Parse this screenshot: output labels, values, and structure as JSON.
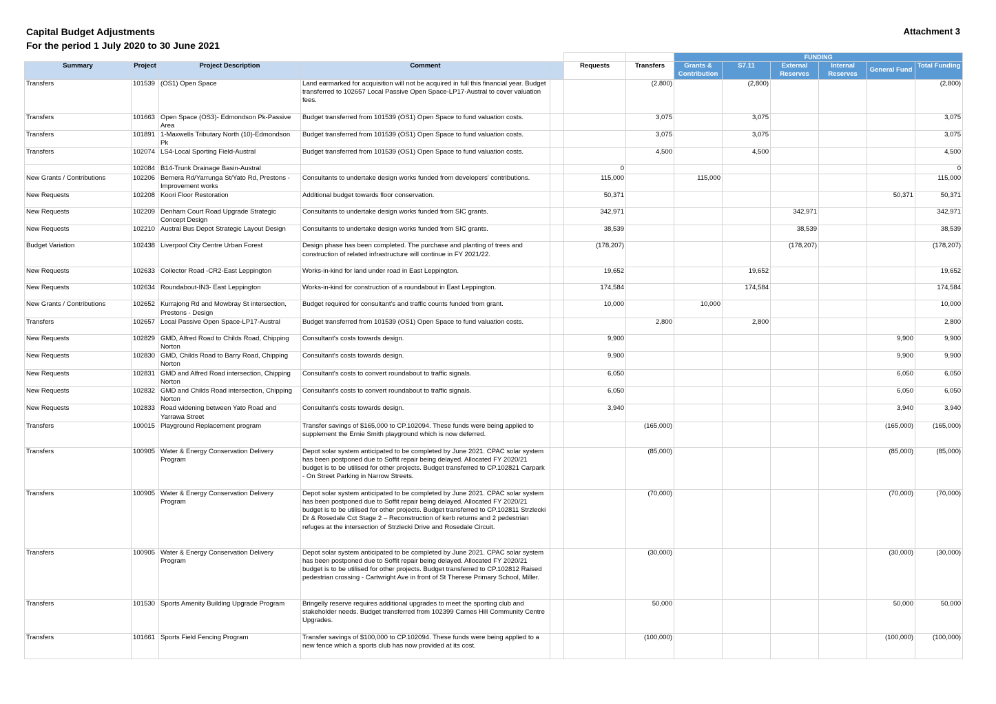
{
  "header": {
    "title_line1": "Capital Budget Adjustments",
    "title_line2": "For the period 1 July 2020 to 30 June 2021",
    "attachment": "Attachment 3"
  },
  "columns": {
    "funding_group": "FUNDING",
    "summary": "Summary",
    "project": "Project",
    "description": "Project Description",
    "comment": "Comment",
    "requests": "Requests",
    "transfers": "Transfers",
    "grants": "Grants & Contribution",
    "s711": "S7.11",
    "external": "External Reserves",
    "internal": "Internal Reserves",
    "general": "General Fund",
    "total": "Total Funding"
  },
  "rows": [
    {
      "summary": "Transfers",
      "project": "101539",
      "description": "(OS1) Open Space",
      "comment": "Land earmarked for acquisition will not be acquired in full this financial year. Budget transferred to 102657 Local Passive Open Space-LP17-Austral to cover valuation fees.",
      "requests": "",
      "transfers": "(2,800)",
      "grants": "",
      "s711": "(2,800)",
      "external": "",
      "internal": "",
      "general": "",
      "total": "(2,800)",
      "h": "three"
    },
    {
      "summary": "Transfers",
      "project": "101663",
      "description": "Open Space (OS3)- Edmondson Pk-Passive Area",
      "comment": "Budget transferred from 101539 (OS1) Open Space to fund valuation costs.",
      "requests": "",
      "transfers": "3,075",
      "grants": "",
      "s711": "3,075",
      "external": "",
      "internal": "",
      "general": "",
      "total": "3,075",
      "h": "norm"
    },
    {
      "summary": "Transfers",
      "project": "101891",
      "description": "1-Maxwells Tributary North (10)-Edmondson Pk",
      "comment": "Budget transferred from 101539 (OS1) Open Space to fund valuation costs.",
      "requests": "",
      "transfers": "3,075",
      "grants": "",
      "s711": "3,075",
      "external": "",
      "internal": "",
      "general": "",
      "total": "3,075",
      "h": "norm"
    },
    {
      "summary": "Transfers",
      "project": "102074",
      "description": "LS4-Local Sporting Field-Austral",
      "comment": "Budget transferred from 101539 (OS1) Open Space to fund valuation costs.",
      "requests": "",
      "transfers": "4,500",
      "grants": "",
      "s711": "4,500",
      "external": "",
      "internal": "",
      "general": "",
      "total": "4,500",
      "h": "norm"
    },
    {
      "summary": "",
      "project": "102084",
      "description": "B14-Trunk Drainage Basin-Austral",
      "comment": "",
      "requests": "0",
      "transfers": "",
      "grants": "",
      "s711": "",
      "external": "",
      "internal": "",
      "general": "",
      "total": "0",
      "h": "short"
    },
    {
      "summary": "New Grants / Contributions",
      "project": "102206",
      "description": "Bernera Rd/Yarrunga St/Yato Rd, Prestons - Improvement works",
      "comment": "Consultants to undertake design works funded from developers' contributions.",
      "requests": "115,000",
      "transfers": "",
      "grants": "115,000",
      "s711": "",
      "external": "",
      "internal": "",
      "general": "",
      "total": "115,000",
      "h": "norm"
    },
    {
      "summary": "New Requests",
      "project": "102208",
      "description": "Koori Floor Restoration",
      "comment": "Additional budget towards floor conservation.",
      "requests": "50,371",
      "transfers": "",
      "grants": "",
      "s711": "",
      "external": "",
      "internal": "",
      "general": "50,371",
      "total": "50,371",
      "h": "norm"
    },
    {
      "summary": "New Requests",
      "project": "102209",
      "description": "Denham Court Road Upgrade Strategic Concept Design",
      "comment": "Consultants to undertake design works funded from SIC grants.",
      "requests": "342,971",
      "transfers": "",
      "grants": "",
      "s711": "",
      "external": "342,971",
      "internal": "",
      "general": "",
      "total": "342,971",
      "h": "norm"
    },
    {
      "summary": "New Requests",
      "project": "102210",
      "description": "Austral Bus Depot Strategic Layout Design",
      "comment": "Consultants to undertake design works funded from SIC grants.",
      "requests": "38,539",
      "transfers": "",
      "grants": "",
      "s711": "",
      "external": "38,539",
      "internal": "",
      "general": "",
      "total": "38,539",
      "h": "norm"
    },
    {
      "summary": "Budget Variation",
      "project": "102438",
      "description": "Liverpool City Centre Urban Forest",
      "comment": "Design phase has been completed.  The purchase and planting of trees and construction of related infrastructure will continue in FY 2021/22.",
      "requests": "(178,207)",
      "transfers": "",
      "grants": "",
      "s711": "",
      "external": "(178,207)",
      "internal": "",
      "general": "",
      "total": "(178,207)",
      "h": "two"
    },
    {
      "summary": "New Requests",
      "project": "102633",
      "description": "Collector Road -CR2-East Leppington",
      "comment": "Works-in-kind for land under road in East Leppington.",
      "requests": "19,652",
      "transfers": "",
      "grants": "",
      "s711": "19,652",
      "external": "",
      "internal": "",
      "general": "",
      "total": "19,652",
      "h": "norm"
    },
    {
      "summary": "New Requests",
      "project": "102634",
      "description": "Roundabout-IN3- East Leppington",
      "comment": "Works-in-kind for construction of a roundabout in East Leppington.",
      "requests": "174,584",
      "transfers": "",
      "grants": "",
      "s711": "174,584",
      "external": "",
      "internal": "",
      "general": "",
      "total": "174,584",
      "h": "norm"
    },
    {
      "summary": "New Grants / Contributions",
      "project": "102652",
      "description": "Kurrajong Rd and Mowbray St intersection, Prestons - Design",
      "comment": "Budget required for consultant's and traffic counts funded from grant.",
      "requests": "10,000",
      "transfers": "",
      "grants": "10,000",
      "s711": "",
      "external": "",
      "internal": "",
      "general": "",
      "total": "10,000",
      "h": "norm"
    },
    {
      "summary": "Transfers",
      "project": "102657",
      "description": "Local Passive Open Space-LP17-Austral",
      "comment": "Budget transferred from 101539 (OS1) Open Space to fund valuation costs.",
      "requests": "",
      "transfers": "2,800",
      "grants": "",
      "s711": "2,800",
      "external": "",
      "internal": "",
      "general": "",
      "total": "2,800",
      "h": "norm"
    },
    {
      "summary": "New Requests",
      "project": "102829",
      "description": "GMD, Alfred Road to Childs Road, Chipping Norton",
      "comment": "Consultant's costs towards design.",
      "requests": "9,900",
      "transfers": "",
      "grants": "",
      "s711": "",
      "external": "",
      "internal": "",
      "general": "9,900",
      "total": "9,900",
      "h": "norm"
    },
    {
      "summary": "New Requests",
      "project": "102830",
      "description": "GMD, Childs Road to Barry Road, Chipping Norton",
      "comment": "Consultant's costs towards design.",
      "requests": "9,900",
      "transfers": "",
      "grants": "",
      "s711": "",
      "external": "",
      "internal": "",
      "general": "9,900",
      "total": "9,900",
      "h": "norm"
    },
    {
      "summary": "New Requests",
      "project": "102831",
      "description": "GMD and Alfred Road intersection, Chipping Norton",
      "comment": "Consultant's costs to convert roundabout to traffic signals.",
      "requests": "6,050",
      "transfers": "",
      "grants": "",
      "s711": "",
      "external": "",
      "internal": "",
      "general": "6,050",
      "total": "6,050",
      "h": "norm"
    },
    {
      "summary": "New Requests",
      "project": "102832",
      "description": "GMD and Childs Road intersection, Chipping Norton",
      "comment": "Consultant's costs to convert roundabout to traffic signals.",
      "requests": "6,050",
      "transfers": "",
      "grants": "",
      "s711": "",
      "external": "",
      "internal": "",
      "general": "6,050",
      "total": "6,050",
      "h": "norm"
    },
    {
      "summary": "New Requests",
      "project": "102833",
      "description": "Road widening between Yato Road and Yarrawa Street",
      "comment": "Consultant's costs towards design.",
      "requests": "3,940",
      "transfers": "",
      "grants": "",
      "s711": "",
      "external": "",
      "internal": "",
      "general": "3,940",
      "total": "3,940",
      "h": "norm"
    },
    {
      "summary": "Transfers",
      "project": "100015",
      "description": "Playground Replacement program",
      "comment": "Transfer savings of $165,000 to CP.102094. These funds were being applied to supplement the Ernie Smith playground which is now deferred.",
      "requests": "",
      "transfers": "(165,000)",
      "grants": "",
      "s711": "",
      "external": "",
      "internal": "",
      "general": "(165,000)",
      "total": "(165,000)",
      "h": "two"
    },
    {
      "summary": "Transfers",
      "project": "100905",
      "description": "Water & Energy Conservation Delivery Program",
      "comment": "Depot solar system anticipated to be completed by June 2021.  CPAC solar system has been postponed due to Soffit repair being delayed.  Allocated FY 2020/21 budget is to be utilised for other projects.  Budget transferred to CP.102821 Carpark - On Street Parking in Narrow Streets.",
      "requests": "",
      "transfers": "(85,000)",
      "grants": "",
      "s711": "",
      "external": "",
      "internal": "",
      "general": "(85,000)",
      "total": "(85,000)",
      "h": "five"
    },
    {
      "summary": "Transfers",
      "project": "100905",
      "description": "Water & Energy Conservation Delivery Program",
      "comment": "Depot solar system anticipated to be completed by June 2021.  CPAC solar system has been postponed due to Soffit repair being delayed.  Allocated FY 2020/21 budget is to be utilised for other projects.  Budget transferred to CP.102811 Strzlecki Dr & Rosedale Cct Stage 2 – Reconstruction of kerb returns and 2 pedestrian refuges at the intersection of Strzlecki Drive and Rosedale Circuit.",
      "requests": "",
      "transfers": "(70,000)",
      "grants": "",
      "s711": "",
      "external": "",
      "internal": "",
      "general": "(70,000)",
      "total": "(70,000)",
      "h": "seven"
    },
    {
      "summary": "Transfers",
      "project": "100905",
      "description": "Water & Energy Conservation Delivery Program",
      "comment": "Depot solar system anticipated to be completed by June 2021.  CPAC solar system has been postponed due to Soffit repair being delayed.  Allocated FY 2020/21 budget is to be utilised for other projects.  Budget transferred to CP.102812 Raised pedestrian crossing - Cartwright Ave in front of St Therese Primary School, Miller.",
      "requests": "",
      "transfers": "(30,000)",
      "grants": "",
      "s711": "",
      "external": "",
      "internal": "",
      "general": "(30,000)",
      "total": "(30,000)",
      "h": "six"
    },
    {
      "summary": "Transfers",
      "project": "101530",
      "description": "Sports Amenity Building Upgrade Program",
      "comment": "Bringelly reserve requires additional upgrades to meet the sporting club and stakeholder needs.  Budget transferred from 102399 Carnes Hill Community Centre Upgrades.",
      "requests": "",
      "transfers": "50,000",
      "grants": "",
      "s711": "",
      "external": "",
      "internal": "",
      "general": "50,000",
      "total": "50,000",
      "h": "three"
    },
    {
      "summary": "Transfers",
      "project": "101661",
      "description": "Sports Field Fencing Program",
      "comment": "Transfer savings of $100,000 to CP.102094. These funds were being applied to a new fence which a sports club has now provided at its cost.",
      "requests": "",
      "transfers": "(100,000)",
      "grants": "",
      "s711": "",
      "external": "",
      "internal": "",
      "general": "(100,000)",
      "total": "(100,000)",
      "h": "two"
    }
  ]
}
